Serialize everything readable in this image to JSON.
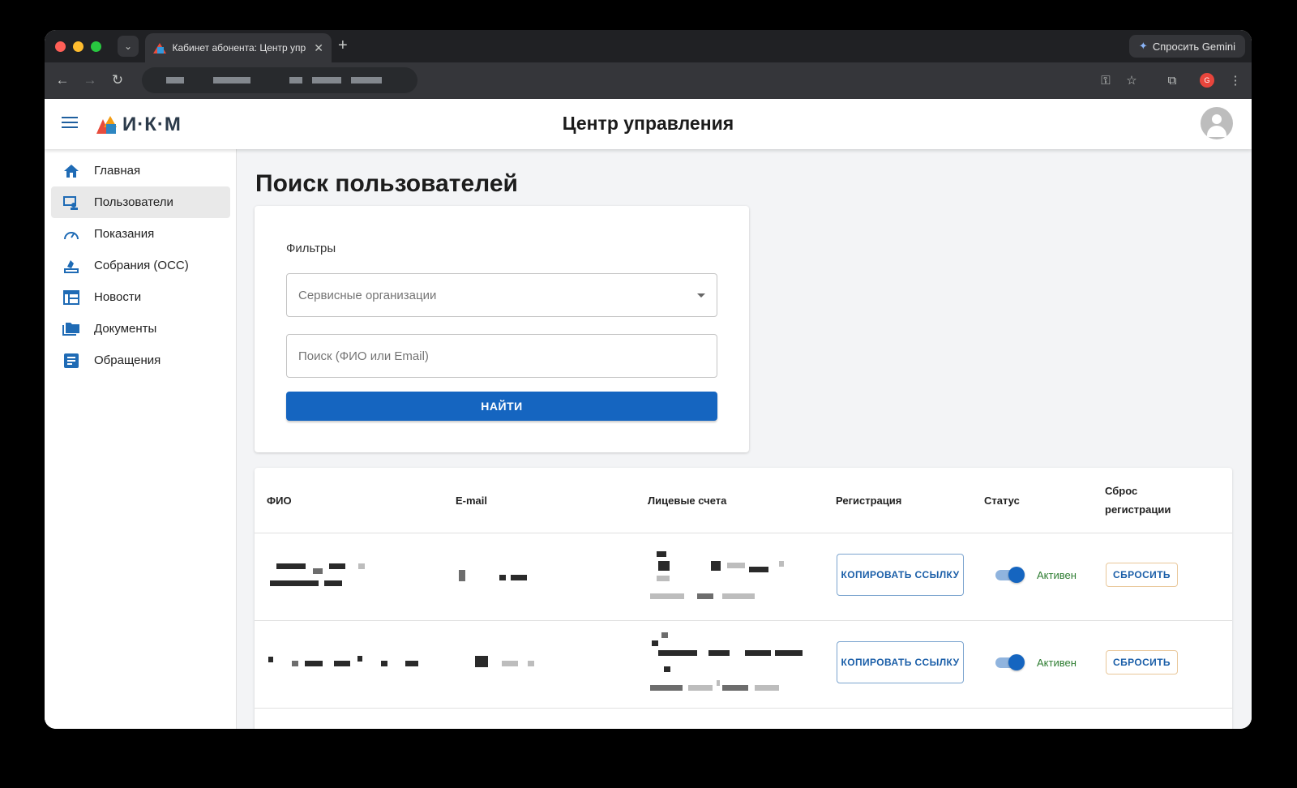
{
  "browser": {
    "tab_title": "Кабинет абонента: Центр управления",
    "gemini_label": "Спросить Gemini",
    "profile_initial": "G"
  },
  "app": {
    "logo_text": "И·К·М",
    "title": "Центр управления"
  },
  "sidebar": {
    "items": [
      {
        "label": "Главная",
        "icon": "home-icon"
      },
      {
        "label": "Пользователи",
        "icon": "users-icon",
        "active": true
      },
      {
        "label": "Показания",
        "icon": "speedometer-icon"
      },
      {
        "label": "Собрания (ОСС)",
        "icon": "vote-icon"
      },
      {
        "label": "Новости",
        "icon": "newspaper-icon"
      },
      {
        "label": "Документы",
        "icon": "folder-icon"
      },
      {
        "label": "Обращения",
        "icon": "document-icon"
      }
    ]
  },
  "page": {
    "title": "Поиск пользователей"
  },
  "filters": {
    "heading": "Фильтры",
    "service_org_placeholder": "Сервисные организации",
    "search_placeholder": "Поиск (ФИО или Email)",
    "find_button": "НАЙТИ"
  },
  "table": {
    "columns": {
      "name": "ФИО",
      "email": "E-mail",
      "accounts": "Лицевые счета",
      "registration": "Регистрация",
      "status": "Статус",
      "reset": "Сброс регистрации"
    },
    "rows": [
      {
        "copy_label": "КОПИРОВАТЬ ССЫЛКУ",
        "status": "Активен",
        "reset_label": "СБРОСИТЬ",
        "enabled": true
      },
      {
        "copy_label": "КОПИРОВАТЬ ССЫЛКУ",
        "status": "Активен",
        "reset_label": "СБРОСИТЬ",
        "enabled": true
      }
    ]
  },
  "colors": {
    "accent": "#1565c0",
    "status_active": "#2e7d32"
  }
}
